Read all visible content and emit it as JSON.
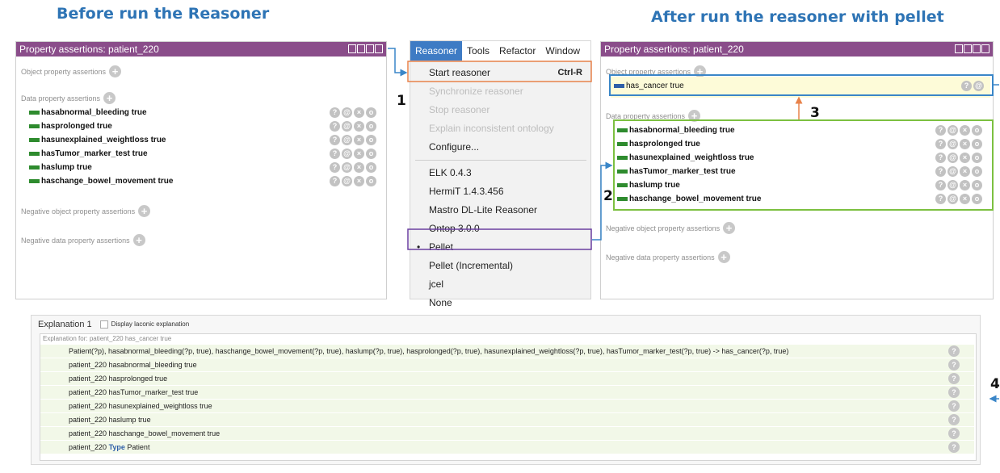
{
  "headings": {
    "before": "Before run the Reasoner",
    "after": "After run the reasoner with pellet"
  },
  "left_panel": {
    "title": "Property assertions: patient_220",
    "object_section": "Object property assertions",
    "data_section": "Data property assertions",
    "rows": [
      "hasabnormal_bleeding true",
      "hasprolonged true",
      "hasunexplained_weightloss true",
      "hasTumor_marker_test true",
      "haslump true",
      "haschange_bowel_movement true"
    ],
    "neg_object": "Negative object property assertions",
    "neg_data": "Negative data property assertions"
  },
  "menu": {
    "bar": [
      "Reasoner",
      "Tools",
      "Refactor",
      "Window"
    ],
    "items": [
      {
        "label": "Start reasoner",
        "shortcut": "Ctrl-R",
        "disabled": false
      },
      {
        "label": "Synchronize reasoner",
        "disabled": true
      },
      {
        "label": "Stop reasoner",
        "disabled": true
      },
      {
        "label": "Explain inconsistent ontology",
        "disabled": true
      },
      {
        "label": "Configure...",
        "disabled": false
      },
      {
        "label": "ELK 0.4.3",
        "disabled": false
      },
      {
        "label": "HermiT 1.4.3.456",
        "disabled": false
      },
      {
        "label": "Mastro DL-Lite Reasoner",
        "disabled": false
      },
      {
        "label": "Ontop 3.0.0",
        "disabled": false
      },
      {
        "label": "Pellet",
        "disabled": false
      },
      {
        "label": "Pellet (Incremental)",
        "disabled": false
      },
      {
        "label": "jcel",
        "disabled": false
      },
      {
        "label": "None",
        "disabled": false
      }
    ],
    "bullet": "•"
  },
  "right_panel": {
    "title": "Property assertions: patient_220",
    "object_section": "Object property assertions",
    "inferred": "has_cancer true",
    "data_section": "Data property assertions",
    "rows": [
      "hasabnormal_bleeding true",
      "hasprolonged true",
      "hasunexplained_weightloss true",
      "hasTumor_marker_test true",
      "haslump true",
      "haschange_bowel_movement true"
    ],
    "neg_object": "Negative object property assertions",
    "neg_data": "Negative data property assertions"
  },
  "markers": {
    "m1": "1",
    "m2": "2",
    "m3": "3",
    "m4": "4"
  },
  "explanation": {
    "title": "Explanation 1",
    "laconic": "Display laconic explanation",
    "for": "Explanation for: patient_220 has_cancer true",
    "rows": [
      "Patient(?p), hasabnormal_bleeding(?p, true), haschange_bowel_movement(?p, true), haslump(?p, true), hasprolonged(?p, true), hasunexplained_weightloss(?p, true), hasTumor_marker_test(?p, true) -> has_cancer(?p, true)",
      "patient_220 hasabnormal_bleeding true",
      "patient_220 hasprolonged true",
      "patient_220 hasTumor_marker_test true",
      "patient_220 hasunexplained_weightloss true",
      "patient_220 haslump true",
      "patient_220 haschange_bowel_movement true"
    ],
    "type_row": {
      "subject": "patient_220",
      "keyword": "Type",
      "object": "Patient"
    }
  },
  "icons": {
    "plus": "+",
    "help": "?",
    "at": "@",
    "x": "×",
    "o": "o"
  },
  "colors": {
    "heading": "#2e74b5",
    "title_bar": "#8a4d8a",
    "menu_active": "#3e7bc4",
    "assert_bar": "#2e8b2e",
    "highlight_orange": "#e8824a",
    "highlight_purple": "#6a3fa0",
    "highlight_blue": "#3a86c8",
    "highlight_green": "#7cc040"
  }
}
